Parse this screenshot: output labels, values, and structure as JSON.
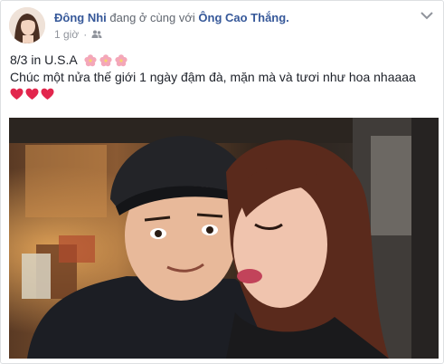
{
  "post": {
    "author": "Đông Nhi",
    "with_text": "đang ở cùng với",
    "tagged": "Ông Cao Thắng.",
    "time": "1 giờ",
    "separator": "·",
    "line1": "8/3 in U.S.A",
    "line2": "Chúc một nửa thế giới 1 ngày đậm đà, mặn mà và tươi như hoa nhaaaa",
    "flower_count": 3,
    "heart_count": 3
  },
  "icons": {
    "privacy": "friends-icon",
    "menu": "chevron-down-icon",
    "emoji1": "cherry-blossom-icon",
    "emoji2": "heart-icon"
  },
  "colors": {
    "link": "#365899",
    "meta": "#90949c",
    "heart": "#e2264d",
    "flower": "#f4a7b9"
  }
}
